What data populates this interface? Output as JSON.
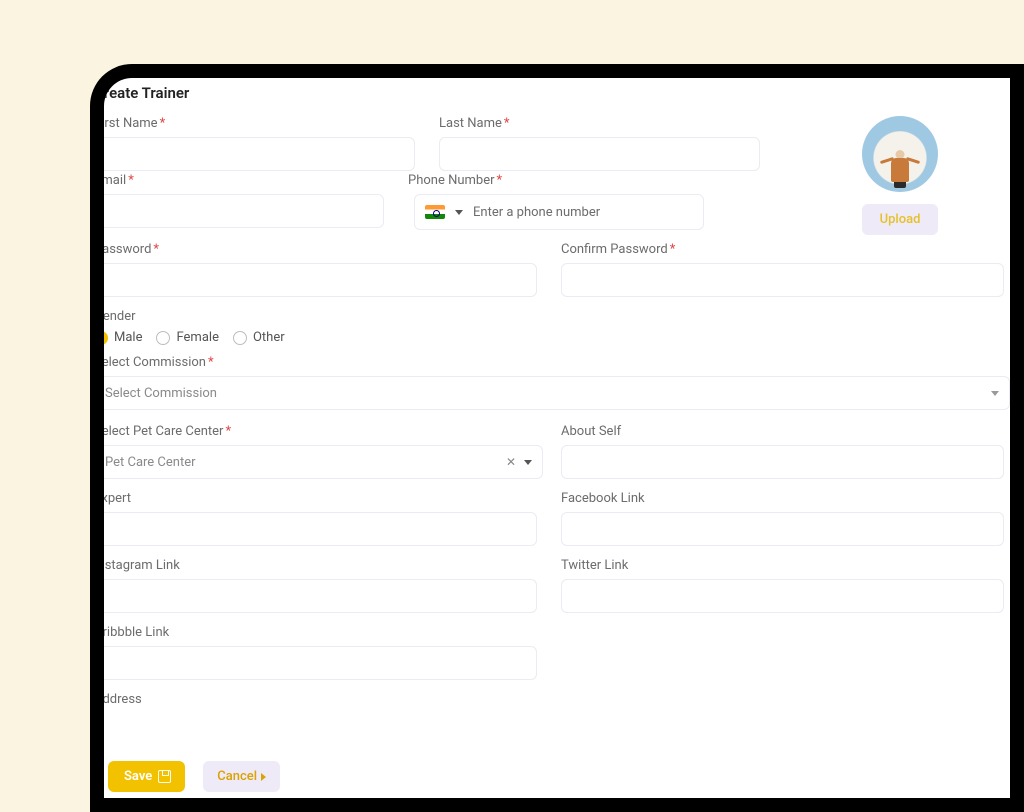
{
  "modalTitle": "Create Trainer",
  "labels": {
    "firstName": "First Name",
    "lastName": "Last Name",
    "email": "Email",
    "phone": "Phone Number",
    "password": "Password",
    "confirmPassword": "Confirm Password",
    "gender": "Gender",
    "selectCommission": "Select Commission",
    "selectPetCareCenter": "Select Pet Care Center",
    "aboutSelf": "About Self",
    "expert": "Expert",
    "facebook": "Facebook Link",
    "instagram": "Instagram Link",
    "twitter": "Twitter Link",
    "dribbble": "Dribbble Link",
    "address": "Address"
  },
  "placeholders": {
    "phone": "Enter a phone number",
    "selectCommission": "Select Commission",
    "petCareCenter": "Pet Care Center"
  },
  "gender": {
    "options": [
      "Male",
      "Female",
      "Other"
    ],
    "selected": "Male"
  },
  "buttons": {
    "upload": "Upload",
    "save": "Save",
    "cancel": "Cancel"
  },
  "phoneCountry": "IN"
}
